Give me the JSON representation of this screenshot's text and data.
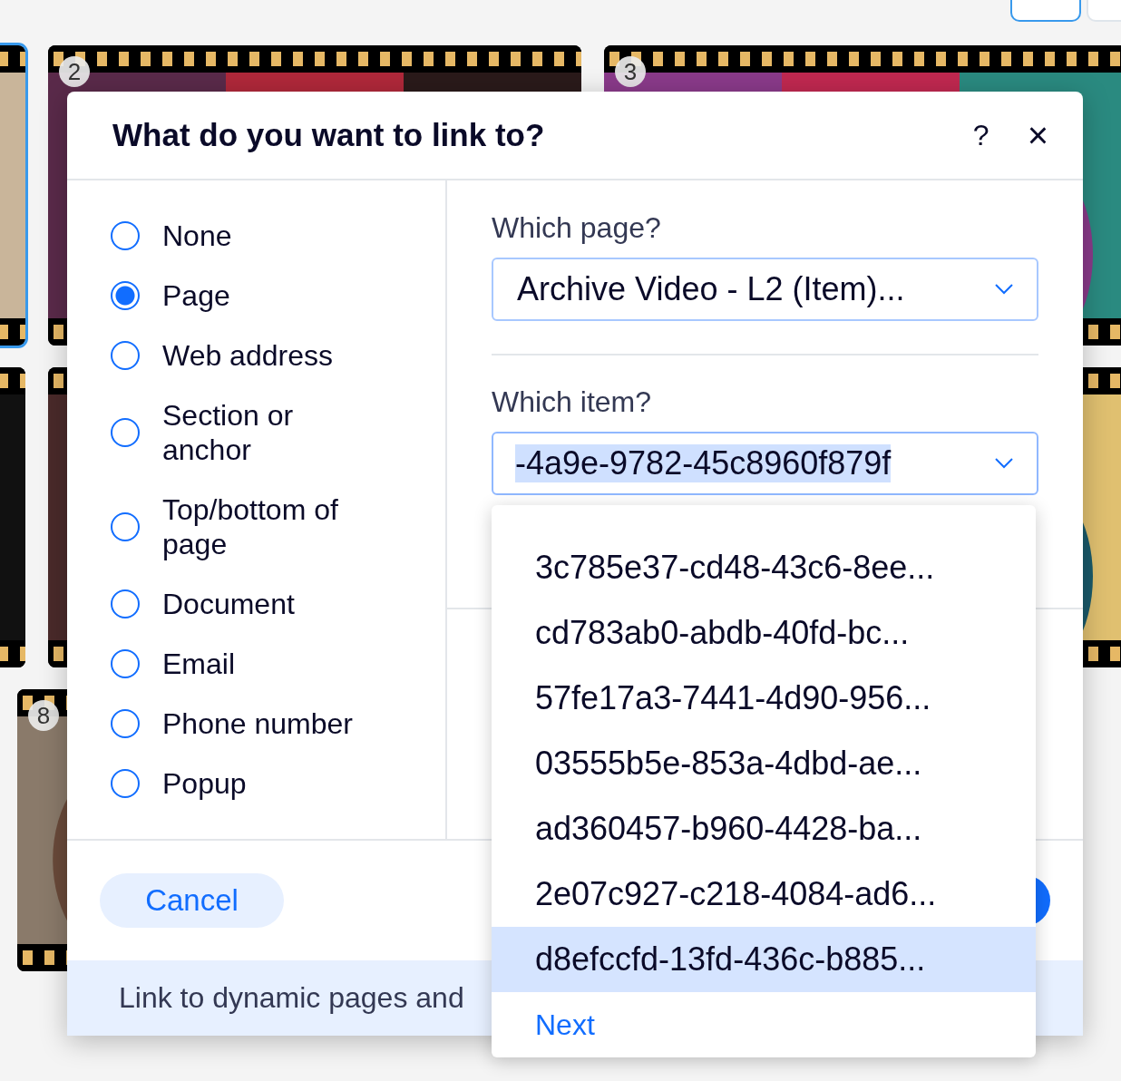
{
  "toolbar": {
    "view_toggles": [
      {
        "selected": true
      },
      {
        "selected": false
      }
    ]
  },
  "gallery": {
    "rows": [
      [
        {
          "selected": true
        },
        {
          "badge": "2",
          "selected": false
        },
        {
          "badge": "3",
          "selected": false
        }
      ],
      [
        {
          "selected": false
        },
        {
          "selected": false
        },
        {
          "selected": false
        }
      ],
      [
        {
          "badge": "8",
          "selected": false
        }
      ]
    ]
  },
  "dialog": {
    "title": "What do you want to link to?",
    "help": "?",
    "close": "×",
    "link_types": [
      {
        "label": "None",
        "selected": false
      },
      {
        "label": "Page",
        "selected": true
      },
      {
        "label": "Web address",
        "selected": false
      },
      {
        "label": "Section or anchor",
        "selected": false
      },
      {
        "label": "Top/bottom of page",
        "selected": false
      },
      {
        "label": "Document",
        "selected": false
      },
      {
        "label": "Email",
        "selected": false
      },
      {
        "label": "Phone number",
        "selected": false
      },
      {
        "label": "Popup",
        "selected": false
      }
    ],
    "page_label": "Which page?",
    "page_value": "Archive Video - L2 (Item)...",
    "item_label": "Which item?",
    "item_value": "-4a9e-9782-45c8960f879f",
    "cancel": "Cancel",
    "info": "Link to dynamic pages and",
    "item_options": [
      {
        "label": "3c785e37-cd48-43c6-8ee...",
        "selected": false
      },
      {
        "label": "cd783ab0-abdb-40fd-bc...",
        "selected": false
      },
      {
        "label": "57fe17a3-7441-4d90-956...",
        "selected": false
      },
      {
        "label": "03555b5e-853a-4dbd-ae...",
        "selected": false
      },
      {
        "label": "ad360457-b960-4428-ba...",
        "selected": false
      },
      {
        "label": "2e07c927-c218-4084-ad6...",
        "selected": false
      },
      {
        "label": "d8efccfd-13fd-436c-b885...",
        "selected": true
      }
    ],
    "next": "Next"
  }
}
